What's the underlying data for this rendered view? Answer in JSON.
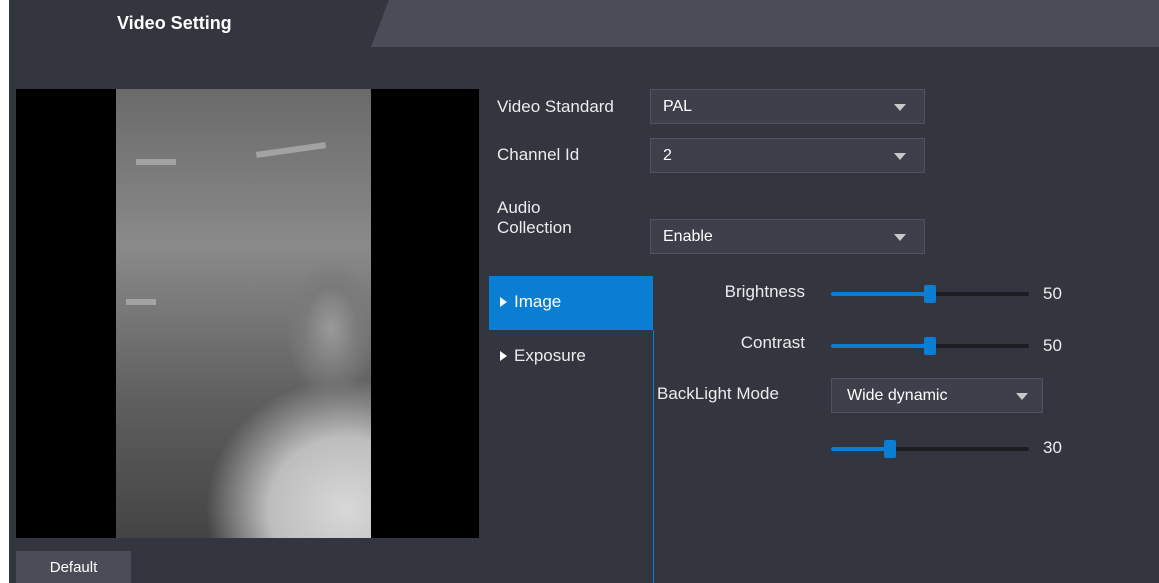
{
  "tabs": [
    {
      "label": "Video Setting",
      "active": true
    }
  ],
  "form": {
    "video_standard": {
      "label": "Video Standard",
      "value": "PAL"
    },
    "channel_id": {
      "label": "Channel Id",
      "value": "2"
    },
    "audio_collection": {
      "label_line1": "Audio",
      "label_line2": "Collection",
      "value": "Enable"
    }
  },
  "nav": {
    "items": [
      {
        "label": "Image",
        "active": true
      },
      {
        "label": "Exposure",
        "active": false
      }
    ]
  },
  "image_settings": {
    "brightness": {
      "label": "Brightness",
      "value": "50",
      "level": 50
    },
    "contrast": {
      "label": "Contrast",
      "value": "50",
      "level": 50
    },
    "backlight_mode": {
      "label": "BackLight Mode",
      "value": "Wide dynamic"
    },
    "backlight_level": {
      "value": "30",
      "level": 30
    }
  },
  "footer": {
    "default_label": "Default"
  },
  "colors": {
    "accent": "#0a7ed3",
    "panel_bg": "#33353f",
    "tab_bar_bg": "#4a4c58"
  },
  "icons": {
    "dropdown": "caret-down-icon",
    "nav_expand": "triangle-right-icon"
  }
}
